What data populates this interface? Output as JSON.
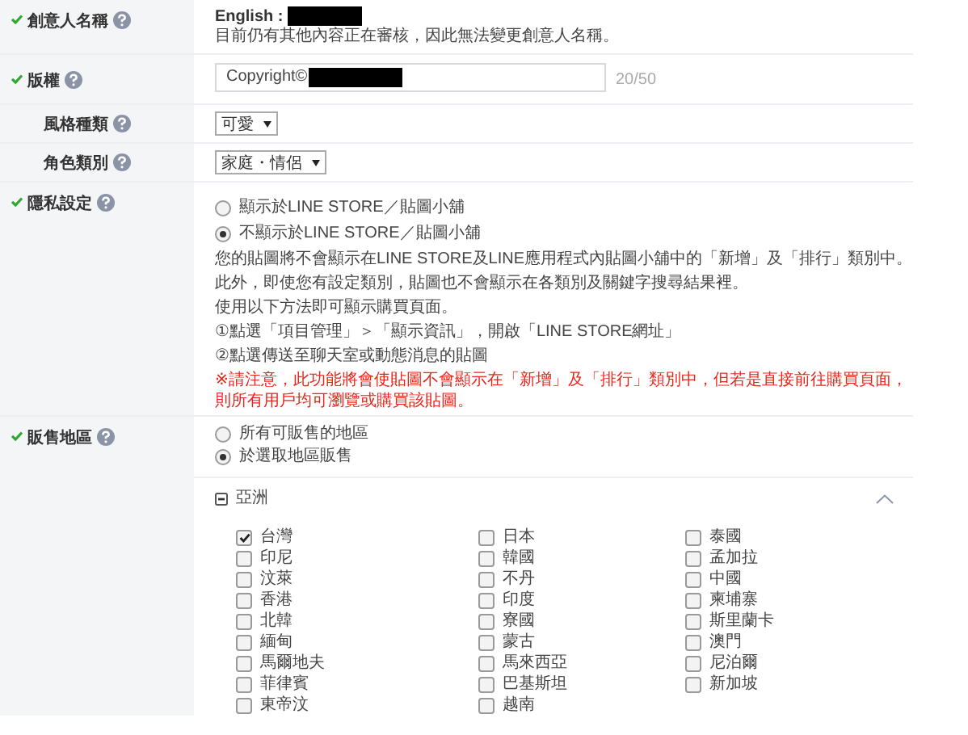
{
  "form": {
    "rows": [
      {
        "kind": "creator",
        "label": "創意人名稱",
        "verified": true,
        "language_label": "English :",
        "note": "目前仍有其他內容正在審核，因此無法變更創意人名稱。"
      },
      {
        "kind": "copyright",
        "label": "版權",
        "verified": true,
        "value": "Copyright©",
        "counter": "20/50"
      },
      {
        "kind": "select",
        "label": "風格種類",
        "verified": false,
        "value": "可愛"
      },
      {
        "kind": "select",
        "label": "角色類別",
        "verified": false,
        "value": "家庭・情侶"
      },
      {
        "kind": "privacy",
        "label": "隱私設定",
        "verified": true,
        "options": [
          {
            "label": "顯示於LINE STORE／貼圖小舖",
            "selected": false
          },
          {
            "label": "不顯示於LINE STORE／貼圖小舖",
            "selected": true
          }
        ],
        "lines": [
          "您的貼圖將不會顯示在LINE STORE及LINE應用程式內貼圖小舖中的「新增」及「排行」類別中。",
          "此外，即使您有設定類別，貼圖也不會顯示在各類別及關鍵字搜尋結果裡。",
          "使用以下方法即可顯示購買頁面。",
          "①點選「項目管理」＞「顯示資訊」，開啟「LINE STORE網址」",
          "②點選傳送至聊天室或動態消息的貼圖"
        ],
        "warning": "※請注意，此功能將會使貼圖不會顯示在「新增」及「排行」類別中，但若是直接前往購買頁面，則所有用戶均可瀏覽或購買該貼圖。"
      },
      {
        "kind": "region",
        "label": "販售地區",
        "verified": true,
        "options": [
          {
            "label": "所有可販售的地區",
            "selected": false
          },
          {
            "label": "於選取地區販售",
            "selected": true
          }
        ],
        "group": {
          "name": "亞洲",
          "expanded": true,
          "countries": [
            {
              "label": "台灣",
              "checked": true
            },
            {
              "label": "日本",
              "checked": false
            },
            {
              "label": "泰國",
              "checked": false
            },
            {
              "label": "印尼",
              "checked": false
            },
            {
              "label": "韓國",
              "checked": false
            },
            {
              "label": "孟加拉",
              "checked": false
            },
            {
              "label": "汶萊",
              "checked": false
            },
            {
              "label": "不丹",
              "checked": false
            },
            {
              "label": "中國",
              "checked": false
            },
            {
              "label": "香港",
              "checked": false
            },
            {
              "label": "印度",
              "checked": false
            },
            {
              "label": "柬埔寨",
              "checked": false
            },
            {
              "label": "北韓",
              "checked": false
            },
            {
              "label": "寮國",
              "checked": false
            },
            {
              "label": "斯里蘭卡",
              "checked": false
            },
            {
              "label": "緬甸",
              "checked": false
            },
            {
              "label": "蒙古",
              "checked": false
            },
            {
              "label": "澳門",
              "checked": false
            },
            {
              "label": "馬爾地夫",
              "checked": false
            },
            {
              "label": "馬來西亞",
              "checked": false
            },
            {
              "label": "尼泊爾",
              "checked": false
            },
            {
              "label": "菲律賓",
              "checked": false
            },
            {
              "label": "巴基斯坦",
              "checked": false
            },
            {
              "label": "新加坡",
              "checked": false
            },
            {
              "label": "東帝汶",
              "checked": false
            },
            {
              "label": "越南",
              "checked": false
            }
          ]
        }
      }
    ]
  }
}
